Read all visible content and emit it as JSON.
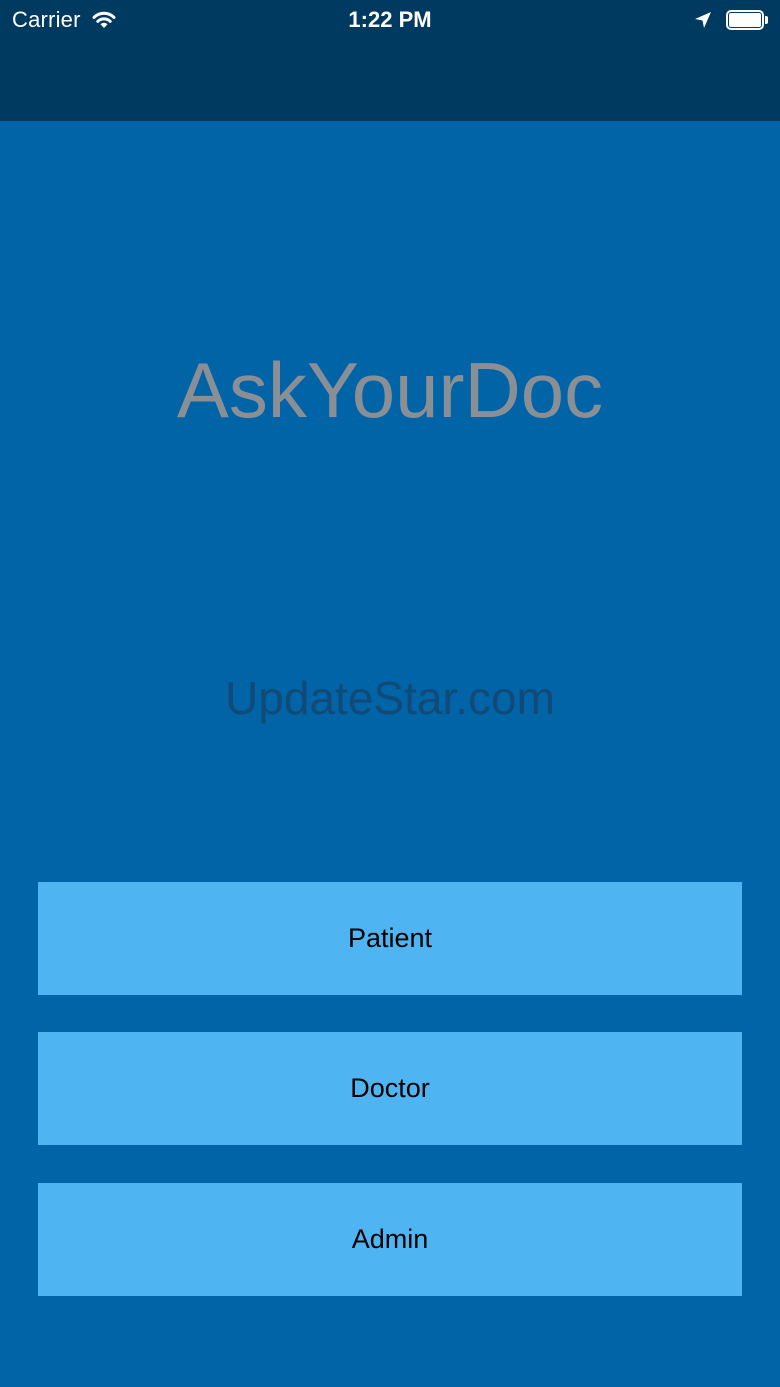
{
  "status_bar": {
    "carrier": "Carrier",
    "time": "1:22 PM",
    "icons": [
      "wifi-icon",
      "location-arrow-icon",
      "battery-icon"
    ]
  },
  "colors": {
    "background": "#0064a6",
    "bars": "#003a60",
    "button": "#4fb4f2",
    "title": "#8a8f95"
  },
  "main": {
    "title": "AskYourDoc",
    "watermark": "UpdateStar.com"
  },
  "buttons": [
    {
      "label": "Patient"
    },
    {
      "label": "Doctor"
    },
    {
      "label": "Admin"
    }
  ]
}
